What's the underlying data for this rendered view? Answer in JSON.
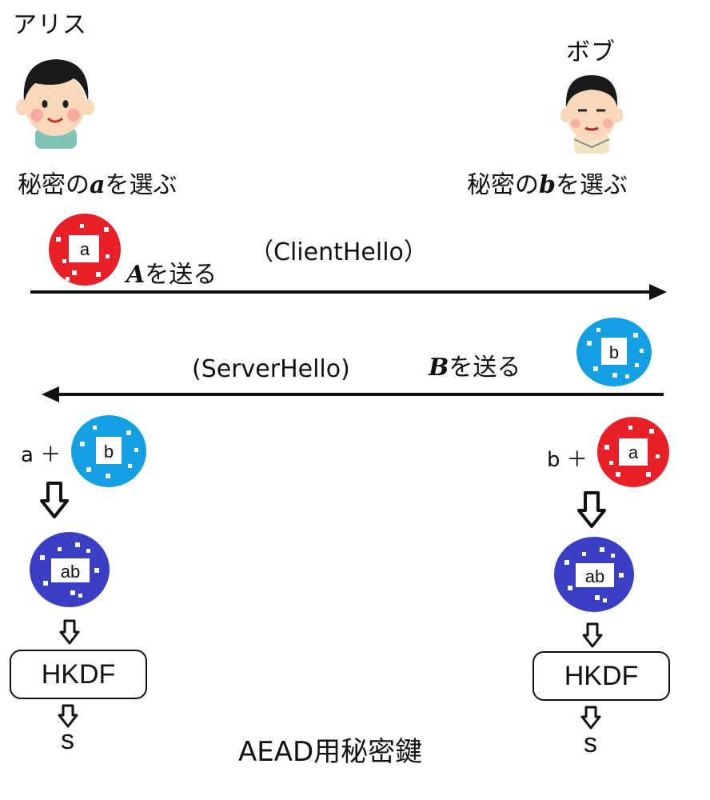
{
  "alice": {
    "name": "アリス",
    "secret_prefix": "秘密の",
    "secret_var": "a",
    "secret_suffix": "を選ぶ"
  },
  "bob": {
    "name": "ボブ",
    "secret_prefix": "秘密の",
    "secret_var": "b",
    "secret_suffix": "を選ぶ"
  },
  "msg1": {
    "label": "（ClientHello）",
    "send_var": "A",
    "send_suffix": "を送る"
  },
  "msg2": {
    "label": "(ServerHello)",
    "send_var": "B",
    "send_suffix": "を送る"
  },
  "tokens": {
    "a": "a",
    "b": "b",
    "shared": "ab"
  },
  "ops": {
    "alice_combine": "a ＋",
    "bob_combine": "b ＋"
  },
  "kdf": {
    "label": "HKDF"
  },
  "result": {
    "alice": "s",
    "bob": "s",
    "caption": "AEAD用秘密鍵"
  },
  "colors": {
    "red": "#e8202a",
    "blue": "#12a0e2",
    "purple": "#3a3fc4"
  },
  "icons": {
    "alice": "boy-face-icon",
    "bob": "man-face-icon"
  }
}
